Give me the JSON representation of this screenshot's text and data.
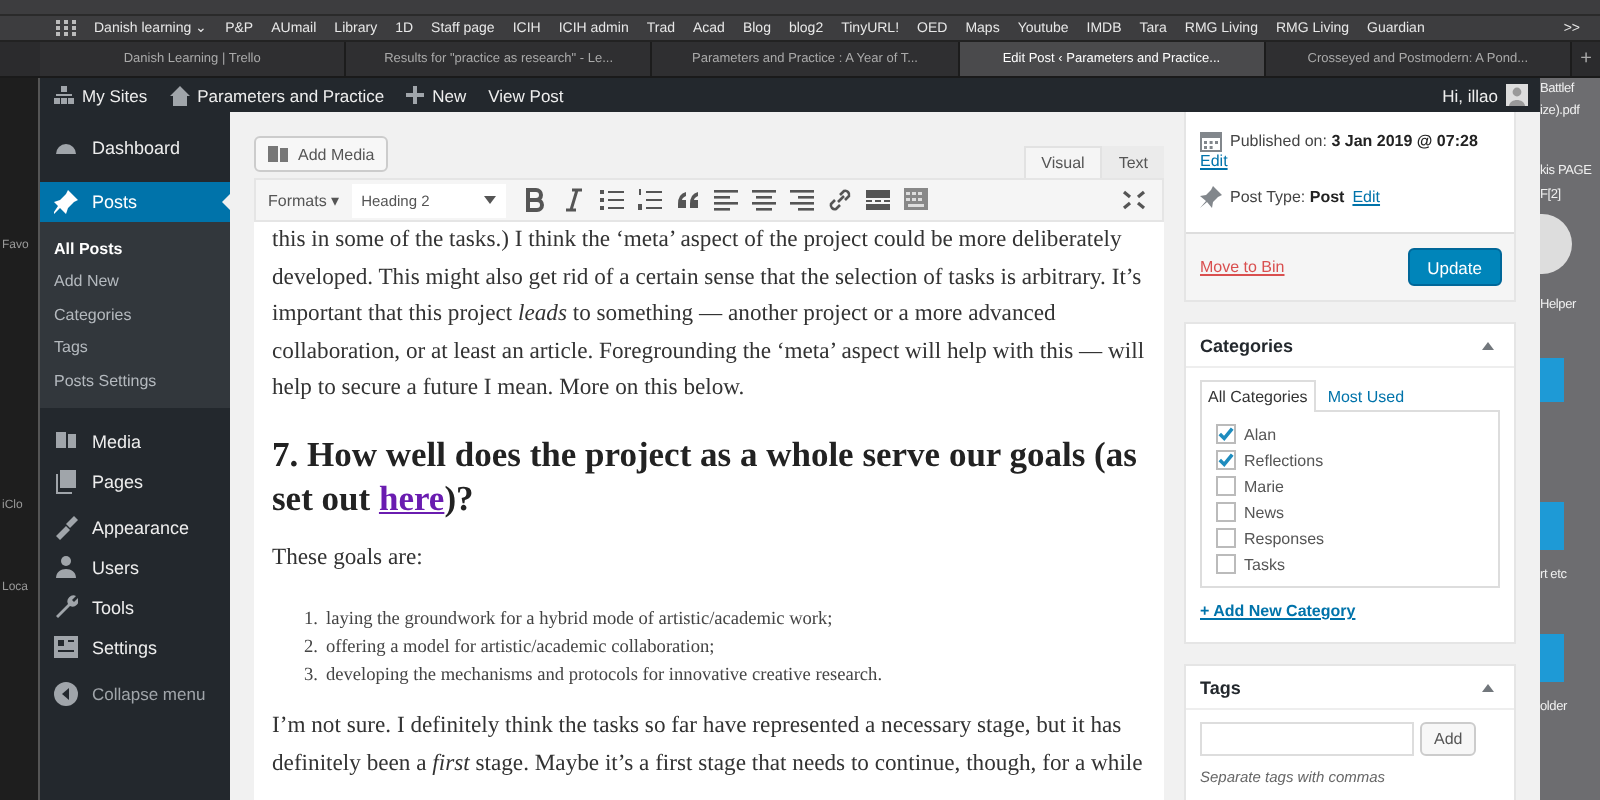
{
  "browser": {
    "bookmarks": [
      "Danish learning ⌄",
      "P&P",
      "AUmail",
      "Library",
      "1D",
      "Staff page",
      "ICIH",
      "ICIH admin",
      "Trad",
      "Acad",
      "Blog",
      "blog2",
      "TinyURL!",
      "OED",
      "Maps",
      "Youtube",
      "IMDB",
      "Tara",
      "RMG Living",
      "RMG Living",
      "Guardian"
    ],
    "bookmarks_more": ">>",
    "tabs": [
      {
        "label": "Danish Learning | Trello",
        "selected": false
      },
      {
        "label": "Results for \"practice as research\" - Le...",
        "selected": false
      },
      {
        "label": "Parameters and Practice : A Year of T...",
        "selected": false
      },
      {
        "label": "Edit Post ‹ Parameters and Practice...",
        "selected": true
      },
      {
        "label": "Crosseyed and Postmodern: A Pond...",
        "selected": false
      }
    ],
    "new_tab": "+"
  },
  "desktop": {
    "left_labels": [
      "Favo",
      "iClo",
      "Loca"
    ],
    "right_labels": [
      "Battlef",
      "ize).pdf",
      "kis PAGE",
      "F[2]",
      "Helper",
      "rt etc",
      "older"
    ]
  },
  "admin_bar": {
    "items": [
      "My Sites",
      "Parameters and Practice",
      "New",
      "View Post"
    ],
    "greeting": "Hi, illao"
  },
  "sidebar": {
    "items": [
      {
        "label": "Dashboard",
        "selected": false
      },
      {
        "label": "Posts",
        "selected": true,
        "children": [
          {
            "label": "All Posts",
            "selected": true
          },
          {
            "label": "Add New",
            "selected": false
          },
          {
            "label": "Categories",
            "selected": false
          },
          {
            "label": "Tags",
            "selected": false
          },
          {
            "label": "Posts Settings",
            "selected": false
          }
        ]
      },
      {
        "label": "Media",
        "selected": false
      },
      {
        "label": "Pages",
        "selected": false
      },
      {
        "label": "Appearance",
        "selected": false
      },
      {
        "label": "Users",
        "selected": false
      },
      {
        "label": "Tools",
        "selected": false
      },
      {
        "label": "Settings",
        "selected": false
      }
    ],
    "collapse": "Collapse menu"
  },
  "editor": {
    "add_media": "Add Media",
    "tabs": [
      {
        "label": "Visual",
        "selected": true
      },
      {
        "label": "Text",
        "selected": false
      }
    ],
    "formats": "Formats ▾",
    "block_format": "Heading 2",
    "content": [
      {
        "kind": "paragraph",
        "text": "this in some of the tasks.) I think the ‘meta’ aspect of the project could be more deliberately developed. This might also get rid of a certain sense that the selection of tasks is arbitrary. It’s important that this project *leads* to something — another project or a more advanced collaboration, or at least an article. Foregrounding the ‘meta’ aspect will help with this — will help to secure a future I mean. More on this below."
      },
      {
        "kind": "heading",
        "text": "7. How well does the project as a whole serve our goals (as set out ",
        "link": "here",
        "after": ")?"
      },
      {
        "kind": "paragraph",
        "text": "These goals are:"
      },
      {
        "kind": "list",
        "items": [
          {
            "number": "1.",
            "text": "laying the groundwork for a hybrid mode of artistic/academic work;"
          },
          {
            "number": "2.",
            "text": "offering a model for artistic/academic collaboration;"
          },
          {
            "number": "3.",
            "text": "developing the mechanisms and protocols for innovative creative research."
          }
        ]
      },
      {
        "kind": "paragraph",
        "text": "I’m not sure. I definitely think the tasks so far have represented a necessary stage, but it has definitely been a *first* stage. Maybe it’s a first stage that needs to continue, though, for a while"
      }
    ]
  },
  "publish": {
    "published": "Published on: **3 Jan 2019 @ 07:28**",
    "published_edit": "Edit",
    "post_type": "Post Type: **Post**",
    "post_type_edit": "Edit",
    "move_to_bin": "Move to Bin",
    "update": "Update"
  },
  "categories": {
    "title": "Categories",
    "tabs": [
      {
        "label": "All Categories",
        "selected": true
      },
      {
        "label": "Most Used",
        "selected": false
      }
    ],
    "items": [
      {
        "label": "Alan",
        "checked": true
      },
      {
        "label": "Reflections",
        "checked": true
      },
      {
        "label": "Marie",
        "checked": false
      },
      {
        "label": "News",
        "checked": false
      },
      {
        "label": "Responses",
        "checked": false
      },
      {
        "label": "Tasks",
        "checked": false
      }
    ],
    "add_new": "+ Add New Category"
  },
  "tags": {
    "title": "Tags",
    "add": "Add",
    "hint": "Separate tags with commas"
  }
}
